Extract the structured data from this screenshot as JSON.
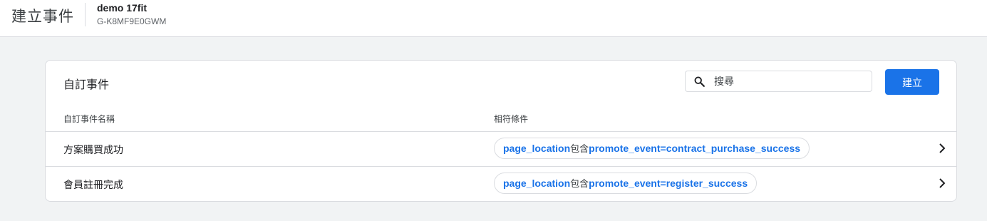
{
  "header": {
    "title": "建立事件",
    "property_name": "demo 17fit",
    "property_id": "G-K8MF9E0GWM"
  },
  "card": {
    "title": "自訂事件",
    "search": {
      "placeholder": "搜尋",
      "value": ""
    },
    "create_label": "建立",
    "columns": {
      "name": "自訂事件名稱",
      "condition": "相符條件"
    },
    "rows": [
      {
        "name": "方案購買成功",
        "condition": {
          "parameter": "page_location",
          "operator": "包含",
          "value": "promote_event=contract_purchase_success"
        }
      },
      {
        "name": "會員註冊完成",
        "condition": {
          "parameter": "page_location",
          "operator": "包含",
          "value": "promote_event=register_success"
        }
      }
    ]
  },
  "colors": {
    "accent": "#1a73e8",
    "background": "#f1f3f4",
    "border": "#dadce0"
  },
  "icons": {
    "search": "search-icon",
    "row_action": "chevron-right-icon"
  }
}
